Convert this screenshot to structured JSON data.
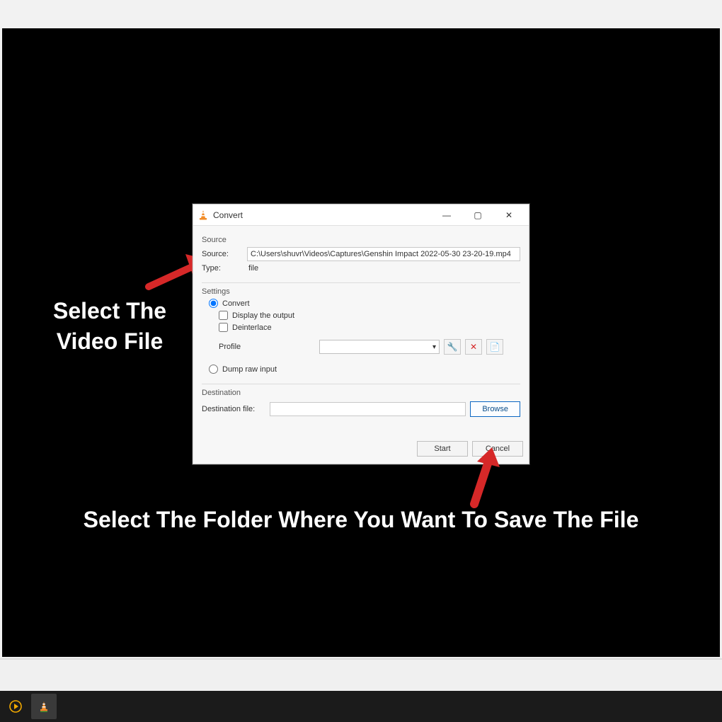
{
  "dialog": {
    "title": "Convert",
    "source": {
      "group_label": "Source",
      "source_label": "Source:",
      "source_value": "C:\\Users\\shuvr\\Videos\\Captures\\Genshin Impact 2022-05-30 23-20-19.mp4",
      "type_label": "Type:",
      "type_value": "file"
    },
    "settings": {
      "group_label": "Settings",
      "convert_label": "Convert",
      "display_output_label": "Display the output",
      "deinterlace_label": "Deinterlace",
      "profile_label": "Profile",
      "profile_value": "",
      "dump_raw_label": "Dump raw input"
    },
    "destination": {
      "group_label": "Destination",
      "dest_file_label": "Destination file:",
      "dest_file_value": "",
      "browse_label": "Browse"
    },
    "buttons": {
      "start_label": "Start",
      "cancel_label": "Cancel"
    }
  },
  "annotations": {
    "left": "Select The Video File",
    "bottom": "Select The Folder Where You Want To Save The File"
  },
  "icons": {
    "minimize": "—",
    "maximize": "▢",
    "close": "✕",
    "wrench": "🔧",
    "delete": "✕",
    "new_profile": "📄",
    "caret": "▾"
  }
}
